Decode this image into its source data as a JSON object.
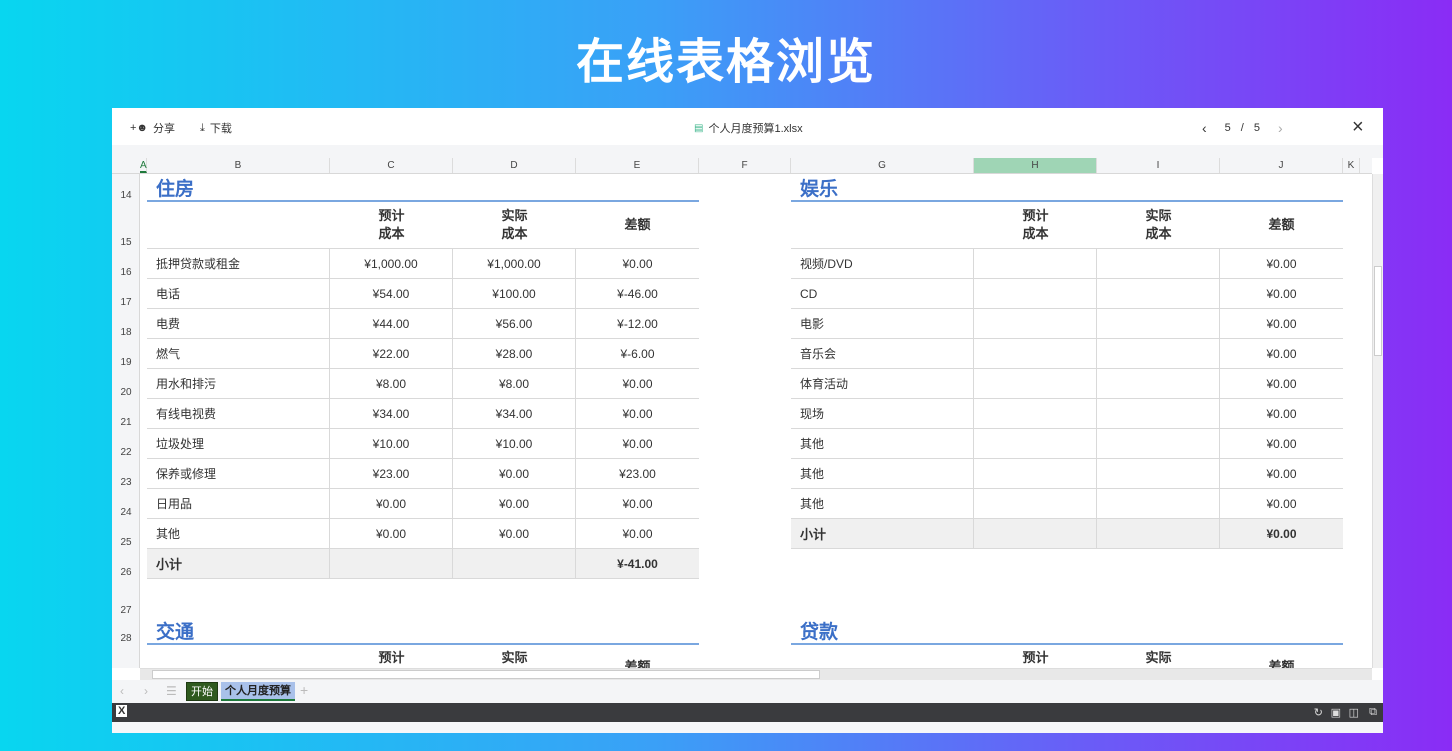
{
  "page_title": "在线表格浏览",
  "toolbar": {
    "share": "分享",
    "download": "下载",
    "filename": "个人月度预算1.xlsx",
    "page_current": "5",
    "page_sep": "/",
    "page_total": "5"
  },
  "columns": [
    "A",
    "B",
    "C",
    "D",
    "E",
    "F",
    "G",
    "H",
    "I",
    "J",
    "K"
  ],
  "rows": [
    "14",
    "15",
    "16",
    "17",
    "18",
    "19",
    "20",
    "21",
    "22",
    "23",
    "24",
    "25",
    "26",
    "27",
    "28"
  ],
  "housing": {
    "title": "住房",
    "headers": [
      "预计\n成本",
      "实际\n成本",
      "差额"
    ],
    "items": [
      [
        "抵押贷款或租金",
        "¥1,000.00",
        "¥1,000.00",
        "¥0.00"
      ],
      [
        "电话",
        "¥54.00",
        "¥100.00",
        "¥-46.00"
      ],
      [
        "电费",
        "¥44.00",
        "¥56.00",
        "¥-12.00"
      ],
      [
        "燃气",
        "¥22.00",
        "¥28.00",
        "¥-6.00"
      ],
      [
        "用水和排污",
        "¥8.00",
        "¥8.00",
        "¥0.00"
      ],
      [
        "有线电视费",
        "¥34.00",
        "¥34.00",
        "¥0.00"
      ],
      [
        "垃圾处理",
        "¥10.00",
        "¥10.00",
        "¥0.00"
      ],
      [
        "保养或修理",
        "¥23.00",
        "¥0.00",
        "¥23.00"
      ],
      [
        "日用品",
        "¥0.00",
        "¥0.00",
        "¥0.00"
      ],
      [
        "其他",
        "¥0.00",
        "¥0.00",
        "¥0.00"
      ]
    ],
    "subtotal_label": "小计",
    "subtotal": "¥-41.00"
  },
  "entertainment": {
    "title": "娱乐",
    "headers": [
      "预计\n成本",
      "实际\n成本",
      "差额"
    ],
    "items": [
      [
        "视频/DVD",
        "",
        "",
        "¥0.00"
      ],
      [
        "CD",
        "",
        "",
        "¥0.00"
      ],
      [
        "电影",
        "",
        "",
        "¥0.00"
      ],
      [
        "音乐会",
        "",
        "",
        "¥0.00"
      ],
      [
        "体育活动",
        "",
        "",
        "¥0.00"
      ],
      [
        "现场",
        "",
        "",
        "¥0.00"
      ],
      [
        "其他",
        "",
        "",
        "¥0.00"
      ],
      [
        "其他",
        "",
        "",
        "¥0.00"
      ],
      [
        "其他",
        "",
        "",
        "¥0.00"
      ]
    ],
    "subtotal_label": "小计",
    "subtotal": "¥0.00"
  },
  "transport": {
    "title": "交通",
    "headers": [
      "预计",
      "实际",
      "差额"
    ]
  },
  "loans": {
    "title": "贷款",
    "headers": [
      "预计",
      "实际",
      "差额"
    ]
  },
  "sheet_tabs": [
    "开始",
    "个人月度预算"
  ],
  "colors": {
    "accent_blue": "#3b6fc7",
    "tab_green": "#2f5a1f",
    "selected_col": "#9fd5b5"
  }
}
